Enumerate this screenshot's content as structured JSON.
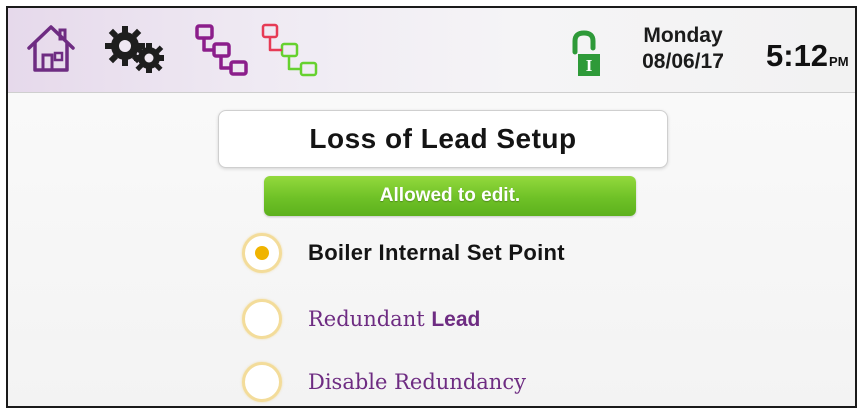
{
  "header": {
    "icons": [
      "home-icon",
      "gear-icon",
      "network-icon",
      "network-icon",
      "lock-icon"
    ],
    "lock_badge": "I",
    "day": "Monday",
    "date": "08/06/17",
    "time": "5:12",
    "ampm": "PM"
  },
  "screen": {
    "title": "Loss of Lead Setup",
    "status": "Allowed to edit."
  },
  "options": [
    {
      "label": "Boiler Internal Set Point",
      "selected": true
    },
    {
      "label_a": "Redundant",
      "label_b": "Lead",
      "selected": false
    },
    {
      "label": "Disable Redundancy",
      "selected": false
    }
  ],
  "colors": {
    "accent_purple": "#6e2c82",
    "network_magenta": "#8b1e8b",
    "network_red": "#e63b55",
    "network_green": "#66d12f",
    "status_green": "#6fc127",
    "radio_selected": "#f0b400",
    "lock_green": "#2e9a39"
  }
}
